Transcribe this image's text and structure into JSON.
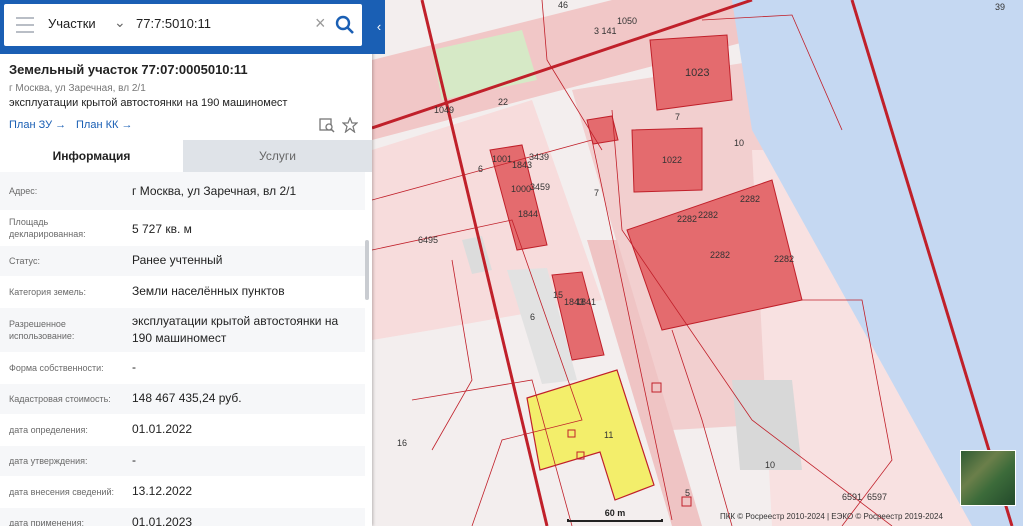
{
  "search": {
    "layer": "Участки",
    "query": "77:7:5010:11"
  },
  "parcel": {
    "title": "Земельный участок 77:07:0005010:11",
    "address_short": "г Москва, ул Заречная, вл 2/1",
    "usage_short": "эксплуатации крытой автостоянки на 190 машиномест",
    "link_plan_zu": "План ЗУ",
    "link_plan_kk": "План КК"
  },
  "tabs": {
    "info": "Информация",
    "services": "Услуги"
  },
  "rows": [
    {
      "label": "Адрес:",
      "value": "г Москва, ул Заречная, вл 2/1"
    },
    {
      "label": "Площадь декларированная:",
      "value": "5 727 кв. м"
    },
    {
      "label": "Статус:",
      "value": "Ранее учтенный"
    },
    {
      "label": "Категория земель:",
      "value": "Земли населённых пунктов"
    },
    {
      "label": "Разрешенное использование:",
      "value": "эксплуатации крытой автостоянки на 190 машиномест"
    },
    {
      "label": "Форма собственности:",
      "value": "-"
    },
    {
      "label": "Кадастровая стоимость:",
      "value": "148 467 435,24 руб."
    },
    {
      "label": "дата определения:",
      "value": "01.01.2022"
    },
    {
      "label": "дата утверждения:",
      "value": "-"
    },
    {
      "label": "дата внесения сведений:",
      "value": "13.12.2022"
    },
    {
      "label": "дата применения:",
      "value": "01.01.2023"
    }
  ],
  "map": {
    "scale_label": "60 m",
    "attribution": "ПКК © Росреестр 2010-2024 | ЕЭКО © Росреестр 2019-2024",
    "labels": {
      "l46": "46",
      "l39": "39",
      "l1050": "1050",
      "l3141": "3 141",
      "l1023": "1023",
      "l1049": "1049",
      "l22": "22",
      "l7a": "7",
      "l10": "10",
      "l1022": "1022",
      "l1001": "1001",
      "l1843": "1843",
      "l3439": "3439",
      "l6a": "6",
      "l7b": "7",
      "l1000": "1000",
      "l3459": "3459",
      "l1844": "1844",
      "l2282a": "2282",
      "l2282b": "2282",
      "l2282c": "2282",
      "l2282d": "2282",
      "l2282e": "2282",
      "l6495": "6495",
      "l15": "15",
      "l1843b": "1843",
      "l1841": "1841",
      "l6b": "6",
      "l11": "11",
      "l16": "16",
      "l10b": "10",
      "l6591": "6591",
      "l6597": "6597",
      "l5": "5"
    },
    "colors": {
      "parcel_outline": "#c0202a",
      "building_fill": "#e46b6e",
      "selected_fill": "#f2ee4a",
      "water": "#c5d8f2",
      "quarter_fill": "#f6d2d2"
    }
  }
}
